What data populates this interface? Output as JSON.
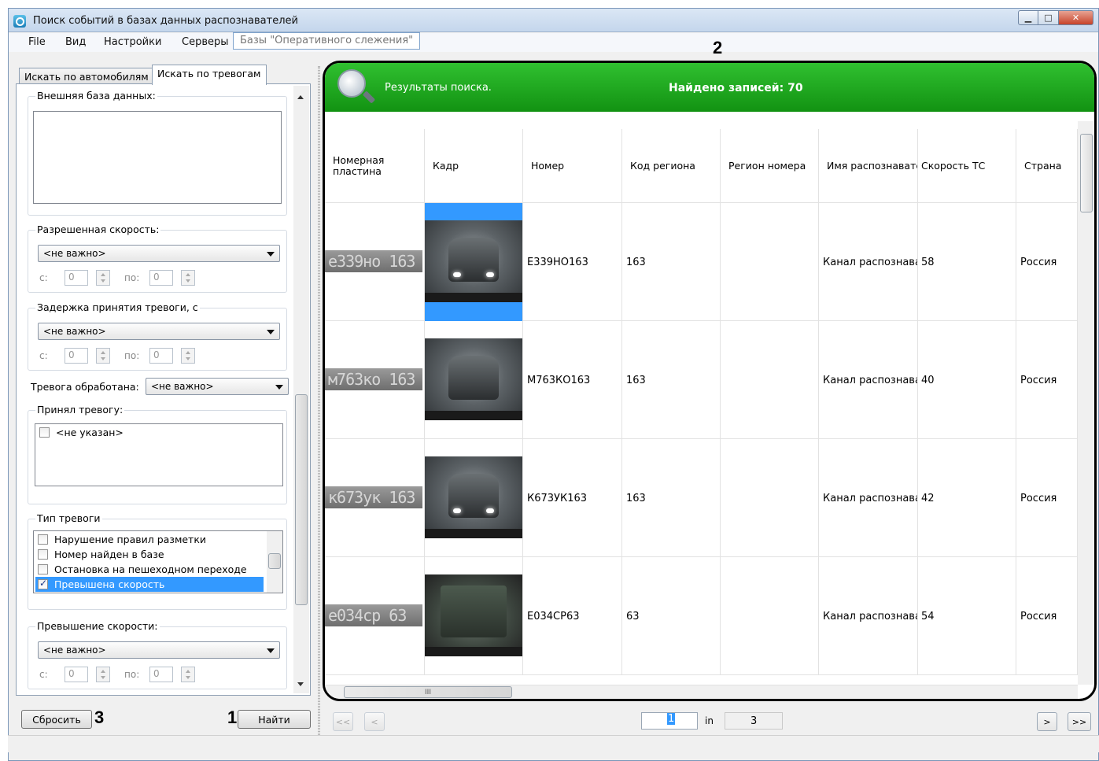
{
  "window": {
    "title": "Поиск событий в базах данных распознавателей"
  },
  "menu": {
    "file": "File",
    "view": "Вид",
    "settings": "Настройки",
    "servers": "Серверы",
    "db_label": "Базы \"Оперативного слежения\""
  },
  "annotations": {
    "n1": "1",
    "n2": "2",
    "n3": "3"
  },
  "tabs": {
    "by_cars": "Искать по автомобилям",
    "by_alarms": "Искать по тревогам"
  },
  "filters": {
    "external_db_label": "Внешняя база данных:",
    "allowed_speed": {
      "label": "Разрешенная скорость:",
      "value": "<не важно>",
      "from_label": "с:",
      "from_value": "0",
      "to_label": "по:",
      "to_value": "0"
    },
    "delay": {
      "label": "Задержка принятия тревоги, с",
      "value": "<не важно>",
      "from_label": "с:",
      "from_value": "0",
      "to_label": "по:",
      "to_value": "0"
    },
    "processed": {
      "label": "Тревога обработана:",
      "value": "<не важно>"
    },
    "accepted_by": {
      "label": "Принял тревогу:",
      "items": [
        {
          "label": "<не указан>",
          "checked": false
        }
      ]
    },
    "alarm_type": {
      "label": "Тип тревоги",
      "items": [
        {
          "label": "Нарушение правил разметки",
          "checked": false
        },
        {
          "label": "Номер найден в базе",
          "checked": false
        },
        {
          "label": "Остановка на пешеходном переходе",
          "checked": false
        },
        {
          "label": "Превышена скорость",
          "checked": true
        }
      ]
    },
    "speed_excess": {
      "label": "Превышение скорости:",
      "value": "<не важно>",
      "from_label": "с:",
      "from_value": "0",
      "to_label": "по:",
      "to_value": "0"
    }
  },
  "buttons": {
    "reset": "Сбросить",
    "find": "Найти"
  },
  "results": {
    "header_text": "Результаты поиска.",
    "found_text": "Найдено записей: 70",
    "columns": [
      "Номерная пластина",
      "Кадр",
      "Номер",
      "Код региона",
      "Регион номера",
      "Имя распознавателя",
      "Скорость ТС",
      "Страна"
    ],
    "rows": [
      {
        "plate_text": "e339но 163",
        "number": "Е339НО163",
        "region_code": "163",
        "region": "",
        "recognizer": "Канал распознавания",
        "speed": "58",
        "country": "Россия",
        "selected": true
      },
      {
        "plate_text": "м763ко 163",
        "number": "М763КО163",
        "region_code": "163",
        "region": "",
        "recognizer": "Канал распознавания",
        "speed": "40",
        "country": "Россия",
        "selected": false
      },
      {
        "plate_text": "к673ук 163",
        "number": "К673УК163",
        "region_code": "163",
        "region": "",
        "recognizer": "Канал распознавания",
        "speed": "42",
        "country": "Россия",
        "selected": false
      },
      {
        "plate_text": "е034ср 63",
        "number": "Е034СР63",
        "region_code": "63",
        "region": "",
        "recognizer": "Канал распознавания",
        "speed": "54",
        "country": "Россия",
        "selected": false
      }
    ],
    "hscroll_glyph": "III"
  },
  "pager": {
    "first": "<<",
    "prev": "<",
    "next": ">",
    "last": ">>",
    "current": "1",
    "of": "in",
    "total": "3"
  },
  "colors": {
    "header_green": "#1aa51a",
    "selection": "#3399ff"
  }
}
